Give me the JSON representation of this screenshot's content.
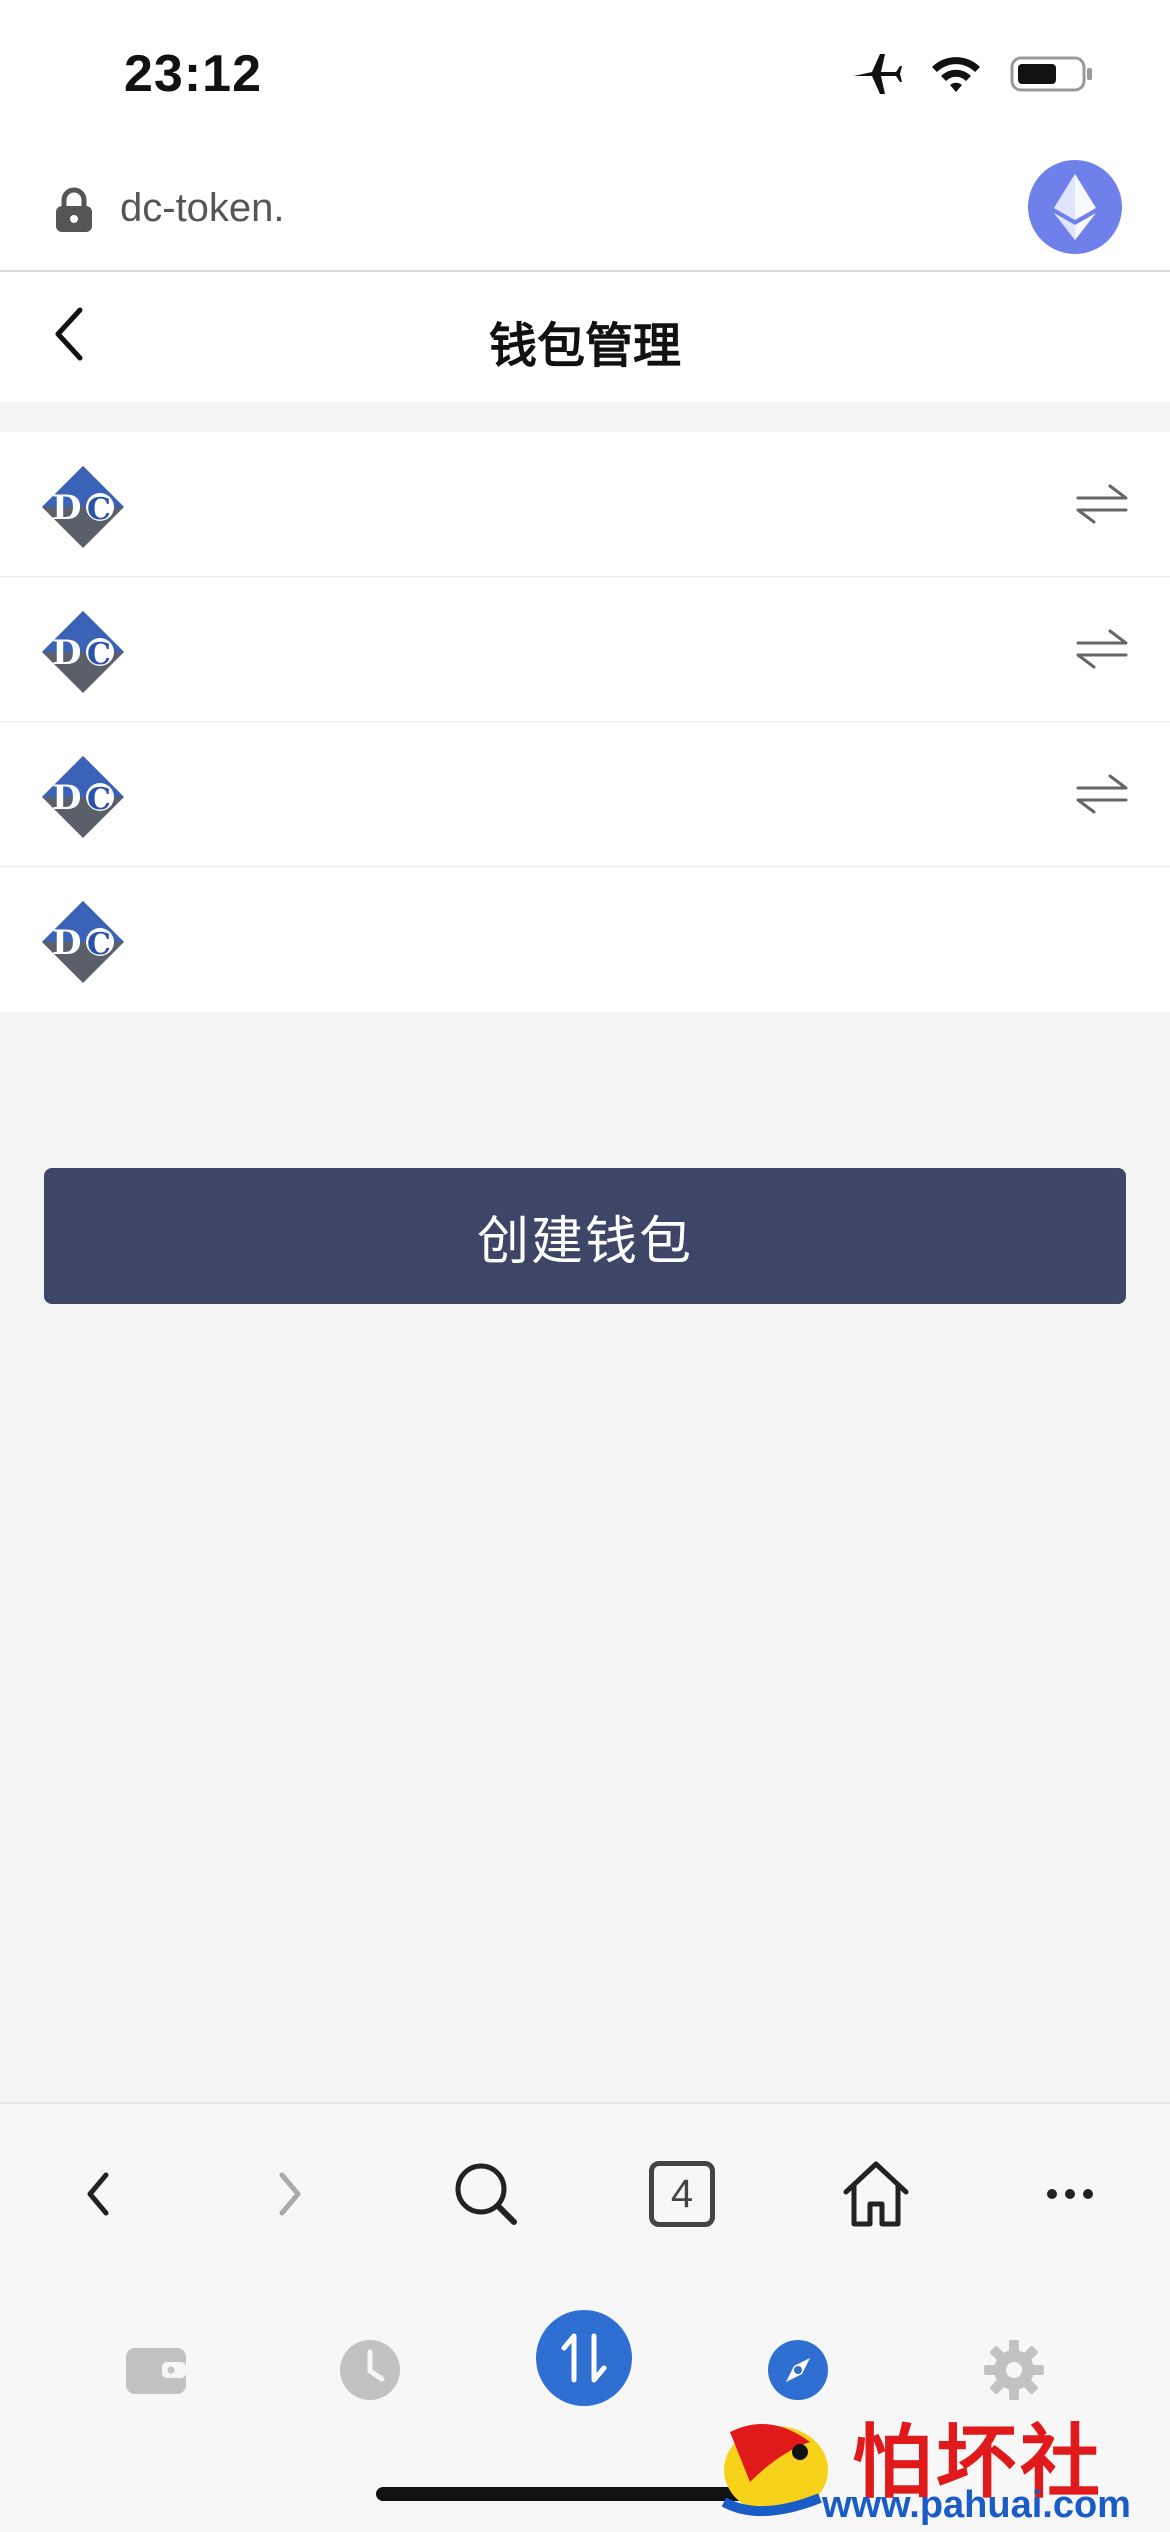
{
  "status_bar": {
    "time": "23:12"
  },
  "url_bar": {
    "url": "dc-token."
  },
  "nav": {
    "title": "钱包管理"
  },
  "wallets": [
    {
      "name": "",
      "switchable": true
    },
    {
      "name": "",
      "switchable": true
    },
    {
      "name": "",
      "switchable": true
    },
    {
      "name": "",
      "switchable": false
    }
  ],
  "actions": {
    "create_wallet": "创建钱包"
  },
  "browser_toolbar": {
    "tab_count": "4"
  },
  "watermark": {
    "text": "怕坏社区",
    "url": "www.pahuai.com"
  },
  "colors": {
    "primary_button": "#3e4668",
    "accent_blue": "#2f6fd1",
    "eth_avatar": "#6f80ea",
    "icon_gray": "#c2c2c2"
  }
}
